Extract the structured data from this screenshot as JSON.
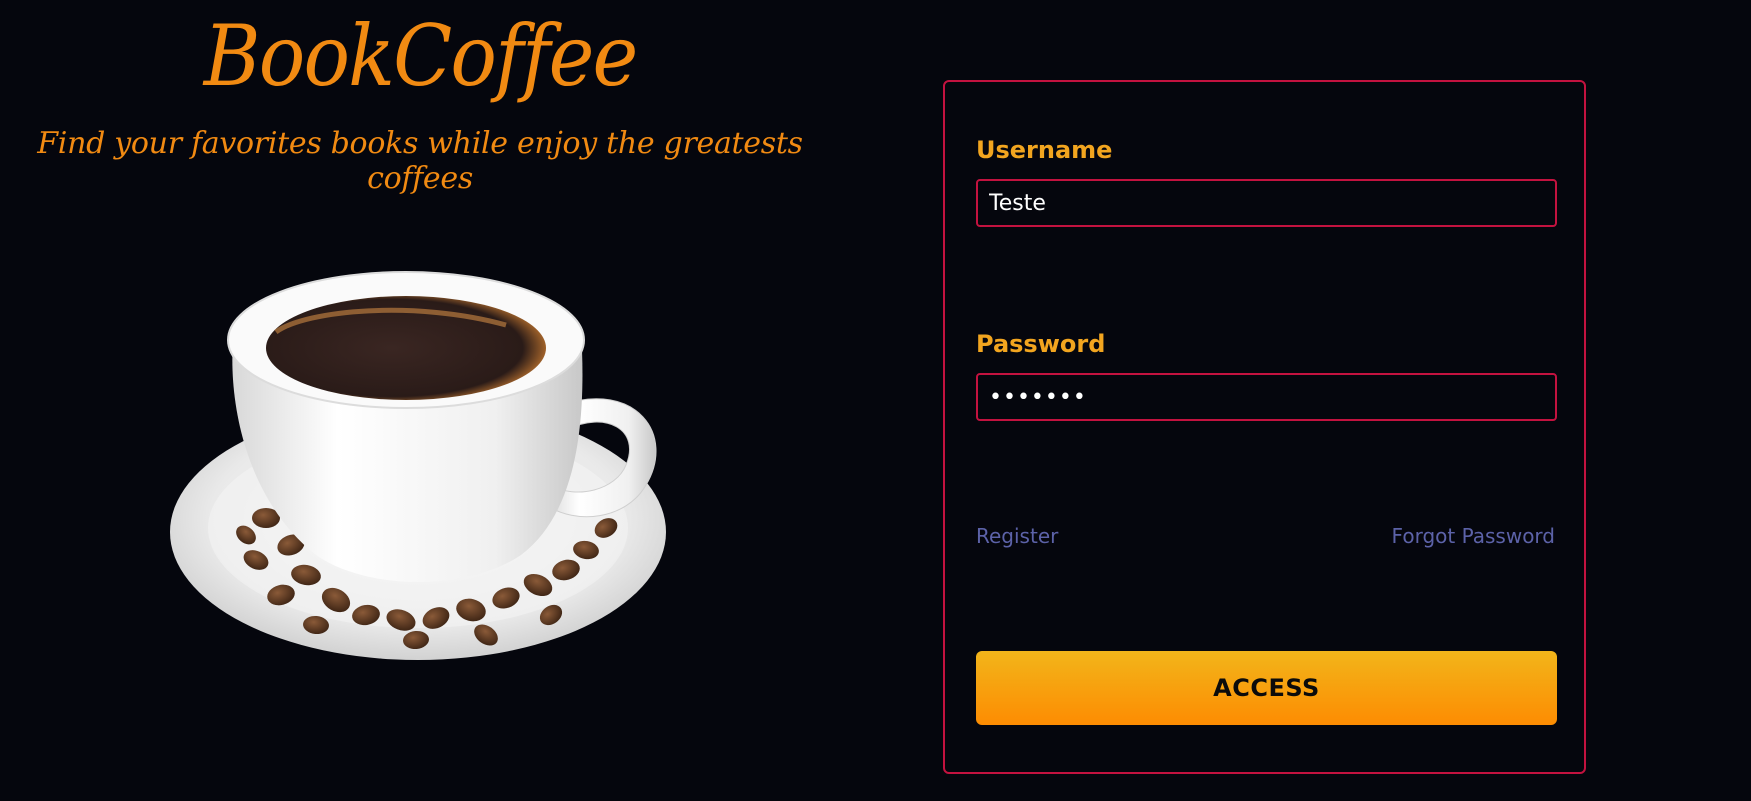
{
  "brand": {
    "title": "BookCoffee",
    "tagline": "Find your favorites books while enjoy the greatests coffees"
  },
  "hero_image": {
    "icon": "coffee-cup-icon"
  },
  "login": {
    "username_label": "Username",
    "username_value": "Teste",
    "password_label": "Password",
    "password_value": "•••••••",
    "register_link": "Register",
    "forgot_link": "Forgot Password",
    "access_button": "ACCESS"
  },
  "colors": {
    "background": "#05060d",
    "brand": "#f18a12",
    "label": "#f2a51f",
    "border": "#c3123f",
    "link": "#5c62a8",
    "button": "#fd8c02"
  }
}
